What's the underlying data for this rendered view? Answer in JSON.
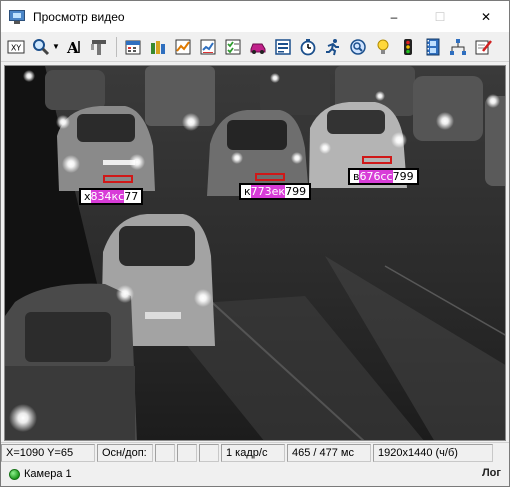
{
  "window": {
    "title": "Просмотр видео",
    "controls": {
      "minimize": "–",
      "maximize": "☐",
      "close": "✕"
    }
  },
  "toolbar": {
    "buttons": [
      "xy-icon",
      "zoom-icon",
      "font-icon",
      "tools-icon",
      "calendar-icon",
      "books-icon",
      "chart-icon",
      "report-icon",
      "checklist-icon",
      "car-icon",
      "document-icon",
      "timer-icon",
      "runner-icon",
      "search-icon",
      "bulb-icon",
      "traffic-light-icon",
      "film-icon",
      "network-icon",
      "edit-icon"
    ],
    "xy_label": "XY",
    "font_label": "A",
    "dropdown_arrow": "▼"
  },
  "video": {
    "plates": [
      {
        "left": "x",
        "mid": "834кс",
        "right": "77"
      },
      {
        "left": "к",
        "mid": "773ек",
        "right": "799"
      },
      {
        "left": "в",
        "mid": "676сс",
        "right": "799"
      }
    ]
  },
  "status": {
    "coords": "X=1090 Y=65",
    "main_extra": "Осн/доп:",
    "empty1": "",
    "empty2": "",
    "empty3": "",
    "fps": "1 кадр/с",
    "timing": "465 / 477 мс",
    "resolution": "1920x1440 (ч/б)"
  },
  "bottom": {
    "camera": "Камера 1",
    "log": "Лог"
  },
  "colors": {
    "plate_box": "#000000",
    "plate_highlight": "#d83cd8",
    "plate_marker": "#d01818",
    "camera_status": "#1f9a1f"
  }
}
